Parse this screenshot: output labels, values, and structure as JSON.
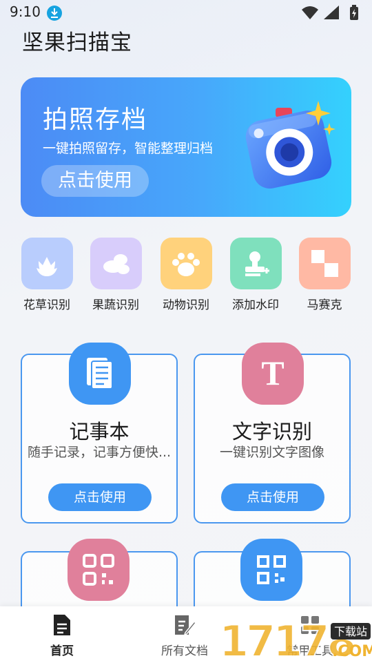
{
  "status_bar": {
    "time": "9:10"
  },
  "app_title": "坚果扫描宝",
  "banner": {
    "title": "拍照存档",
    "subtitle": "一键拍照留存，智能整理归档",
    "button": "点击使用"
  },
  "features": [
    {
      "label": "花草识别",
      "icon": "flower-icon",
      "color": "#b9cdfd"
    },
    {
      "label": "果蔬识别",
      "icon": "vegetables-icon",
      "color": "#d8cdfb"
    },
    {
      "label": "动物识别",
      "icon": "paw-icon",
      "color": "#ffd27c"
    },
    {
      "label": "添加水印",
      "icon": "stamp-icon",
      "color": "#7fe0bd"
    },
    {
      "label": "马赛克",
      "icon": "mosaic-icon",
      "color": "#ffb9a4"
    }
  ],
  "cards": [
    {
      "title": "记事本",
      "desc": "随手记录，记事方便快...",
      "button": "点击使用",
      "icon": "notepad-icon",
      "color": "#3f96f3"
    },
    {
      "title": "文字识别",
      "desc": "一键识别文字图像",
      "button": "点击使用",
      "icon": "text-recognition-icon",
      "color": "#e0809b"
    },
    {
      "icon": "qr-code-icon",
      "color": "#e0809b"
    },
    {
      "icon": "qr-scan-icon",
      "color": "#3f96f3"
    }
  ],
  "bottom_nav": [
    {
      "label": "首页",
      "icon": "document-icon",
      "active": true
    },
    {
      "label": "所有文档",
      "icon": "edit-document-icon",
      "active": false
    },
    {
      "label": "常用工具",
      "icon": "tools-icon",
      "active": false
    }
  ],
  "watermark": {
    "text": "17178",
    "badge": "下载站",
    "suffix": ".COM"
  }
}
